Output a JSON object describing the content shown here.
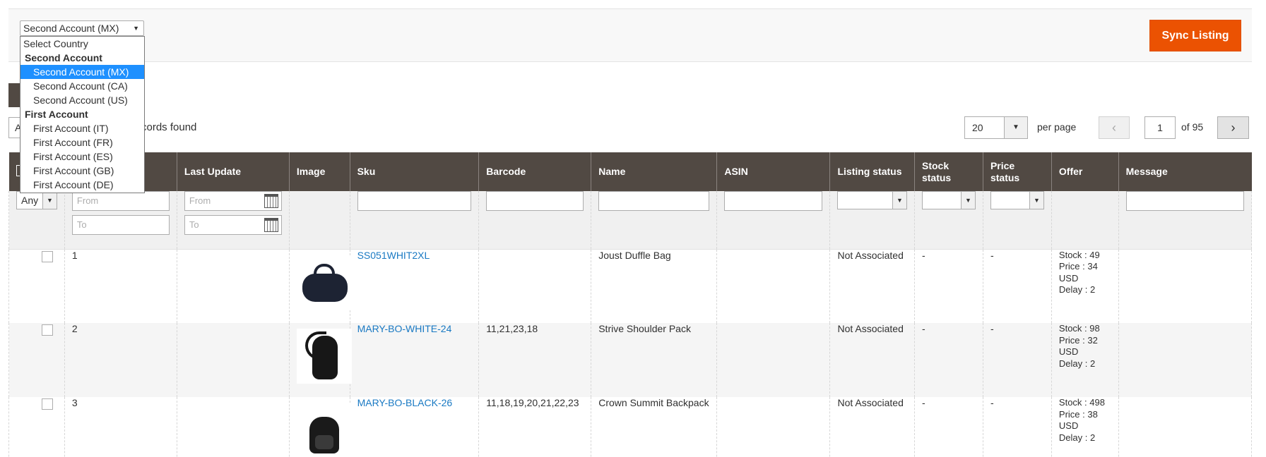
{
  "country_select": {
    "selected": "Second Account (MX)",
    "options": [
      {
        "type": "placeholder",
        "label": "Select Country"
      },
      {
        "type": "group",
        "label": "Second Account"
      },
      {
        "type": "option",
        "label": "Second Account (MX)",
        "selected": true
      },
      {
        "type": "option",
        "label": "Second Account (CA)"
      },
      {
        "type": "option",
        "label": "Second Account (US)"
      },
      {
        "type": "group",
        "label": "First Account"
      },
      {
        "type": "option",
        "label": "First Account (IT)"
      },
      {
        "type": "option",
        "label": "First Account (FR)"
      },
      {
        "type": "option",
        "label": "First Account (ES)"
      },
      {
        "type": "option",
        "label": "First Account (GB)"
      },
      {
        "type": "option",
        "label": "First Account (DE)"
      }
    ]
  },
  "toolbar": {
    "sync_label": "Sync Listing",
    "records_found_visible": "cords found",
    "action_value": "A",
    "per_page_value": "20",
    "per_page_label": "per page",
    "page_value": "1",
    "of_pages": "of 95",
    "prev_icon": "‹",
    "next_icon": "›"
  },
  "grid": {
    "columns": [
      "",
      "",
      "Last Update",
      "Image",
      "Sku",
      "Barcode",
      "Name",
      "ASIN",
      "Listing status",
      "Stock status",
      "Price status",
      "Offer",
      "Message"
    ],
    "filters": {
      "any_label": "Any",
      "from_placeholder": "From",
      "to_placeholder": "To"
    },
    "rows": [
      {
        "id": "1",
        "image": "duffle-bag",
        "sku": "SS051WHIT2XL",
        "barcode": "",
        "name": "Joust Duffle Bag",
        "asin": "",
        "listing_status": "Not Associated",
        "stock_status": "-",
        "price_status": "-",
        "offer": [
          "Stock : 49",
          "Price : 34",
          "USD",
          "Delay : 2"
        ],
        "message": ""
      },
      {
        "id": "2",
        "image": "shoulder-pack",
        "sku": "MARY-BO-WHITE-24",
        "barcode": "11,21,23,18",
        "name": "Strive Shoulder Pack",
        "asin": "",
        "listing_status": "Not Associated",
        "stock_status": "-",
        "price_status": "-",
        "offer": [
          "Stock : 98",
          "Price : 32",
          "USD",
          "Delay : 2"
        ],
        "message": ""
      },
      {
        "id": "3",
        "image": "backpack",
        "sku": "MARY-BO-BLACK-26",
        "barcode": "11,18,19,20,21,22,23",
        "name": "Crown Summit Backpack",
        "asin": "",
        "listing_status": "Not Associated",
        "stock_status": "-",
        "price_status": "-",
        "offer": [
          "Stock : 498",
          "Price : 38",
          "USD",
          "Delay : 2"
        ],
        "message": ""
      }
    ]
  },
  "colors": {
    "header_bg": "#514943",
    "accent": "#eb5202",
    "link": "#1979c3",
    "dropdown_selected": "#1e90ff"
  }
}
